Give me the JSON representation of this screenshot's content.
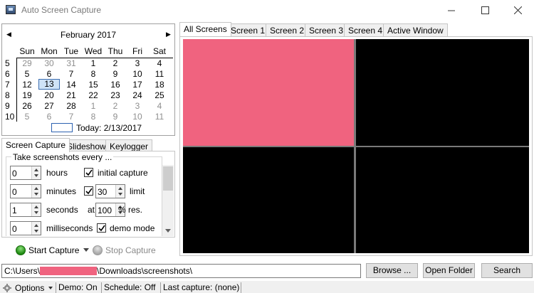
{
  "window": {
    "title": "Auto Screen Capture",
    "controls": [
      "minimize-icon",
      "maximize-icon",
      "close-icon"
    ]
  },
  "calendar": {
    "month_label": "February 2017",
    "day_headers": [
      "Sun",
      "Mon",
      "Tue",
      "Wed",
      "Thu",
      "Fri",
      "Sat"
    ],
    "week_numbers": [
      "5",
      "6",
      "7",
      "8",
      "9",
      "10"
    ],
    "weeks": [
      [
        "29",
        "30",
        "31",
        "1",
        "2",
        "3",
        "4"
      ],
      [
        "5",
        "6",
        "7",
        "8",
        "9",
        "10",
        "11"
      ],
      [
        "12",
        "13",
        "14",
        "15",
        "16",
        "17",
        "18"
      ],
      [
        "19",
        "20",
        "21",
        "22",
        "23",
        "24",
        "25"
      ],
      [
        "26",
        "27",
        "28",
        "1",
        "2",
        "3",
        "4"
      ],
      [
        "5",
        "6",
        "7",
        "8",
        "9",
        "10",
        "11"
      ]
    ],
    "selected_day": "13",
    "today_label": "Today: 2/13/2017"
  },
  "left_tabs": [
    "Screen Capture",
    "Slideshow",
    "Keylogger"
  ],
  "capture": {
    "group_label": "Take screenshots every ...",
    "hours": {
      "value": "0",
      "label": "hours"
    },
    "minutes": {
      "value": "0",
      "label": "minutes"
    },
    "seconds": {
      "value": "1",
      "label": "seconds"
    },
    "milliseconds": {
      "value": "0",
      "label": "milliseconds"
    },
    "initial_capture_label": "initial capture",
    "limit_value": "30",
    "limit_label": "limit",
    "at_label": "at",
    "resolution_value": "100",
    "resolution_label": "% res.",
    "demo_mode_label": "demo mode"
  },
  "actions": {
    "start_label": "Start Capture",
    "stop_label": "Stop Capture"
  },
  "right_tabs": [
    "All Screens",
    "Screen 1",
    "Screen 2",
    "Screen 3",
    "Screen 4",
    "Active Window"
  ],
  "path": {
    "prefix": "C:\\Users\\",
    "suffix": "\\Downloads\\screenshots\\"
  },
  "buttons": {
    "browse": "Browse ...",
    "open_folder": "Open Folder",
    "search": "Search"
  },
  "status": {
    "options": "Options",
    "demo": "Demo: On",
    "schedule": "Schedule: Off",
    "last_capture": "Last capture: (none)"
  },
  "colors": {
    "screen1": "#f0637f",
    "screen_blank": "#000000",
    "redaction": "#f0637f"
  }
}
